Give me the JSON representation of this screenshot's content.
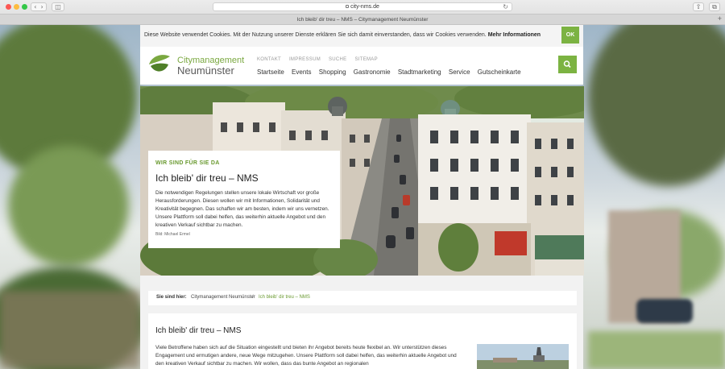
{
  "browser": {
    "url": "city-nms.de",
    "tab_title": "Ich bleib' dir treu – NMS – Citymanagement Neumünster",
    "new_tab": "+"
  },
  "cookie": {
    "text": "Diese Website verwendet Cookies. Mit der Nutzung unserer Dienste erklären Sie sich damit einverstanden, dass wir Cookies verwenden.",
    "more": "Mehr Informationen",
    "ok": "OK"
  },
  "logo": {
    "line1": "Citymanagement",
    "line2": "Neumünster"
  },
  "meta_nav": [
    "KONTAKT",
    "IMPRESSUM",
    "SUCHE",
    "SITEMAP"
  ],
  "main_nav": [
    "Startseite",
    "Events",
    "Shopping",
    "Gastronomie",
    "Stadtmarketing",
    "Service",
    "Gutscheinkarte"
  ],
  "hero": {
    "kicker": "WIR SIND FÜR SIE DA",
    "title": "Ich bleib' dir treu – NMS",
    "text": "Die notwendigen Regelungen stellen unsere lokale Wirtschaft vor große Herausforderungen. Diesen wollen wir mit Informationen, Solidarität und Kreativität begegnen. Das schaffen wir am besten, indem wir uns vernetzen. Unsere Plattform soll dabei helfen, das weiterhin aktuelle Angebot und den kreativen Verkauf sichtbar zu machen.",
    "credit": "Bild: Michael Ermel"
  },
  "breadcrumb": {
    "label": "Sie sind hier:",
    "home": "Citymanagement Neumünster",
    "separator": "/",
    "current": "Ich bleib' dir treu – NMS"
  },
  "article": {
    "title": "Ich bleib' dir treu – NMS",
    "text": "Viele Betroffene haben sich auf die Situation eingestellt und bieten ihr Angebot bereits heute flexibel an. Wir unterstützen dieses Engagement und ermutigen andere, neue Wege mitzugehen. Unsere Plattform soll dabei helfen, das weiterhin aktuelle Angebot und den kreativen Verkauf sichtbar zu machen. Wir wollen, dass das bunte Angebot an regionalen"
  },
  "colors": {
    "accent": "#7cb342",
    "accent_text": "#6a9a30"
  }
}
